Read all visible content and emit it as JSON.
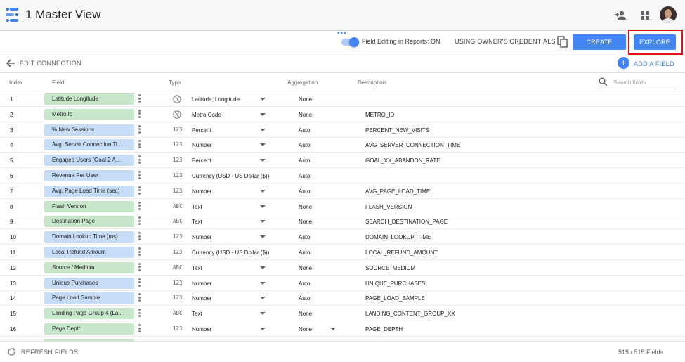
{
  "app": {
    "title": "1 Master View"
  },
  "toolbar": {
    "field_editing_label": "Field Editing in Reports: ON",
    "credentials_label": "USING OWNER'S CREDENTIALS",
    "create_report_label": "CREATE REPORT",
    "explore_label": "EXPLORE",
    "accent_color": "#4285f4",
    "highlight_color": "#e3101b"
  },
  "edit_bar": {
    "title": "EDIT CONNECTION",
    "add_field_label": "ADD A FIELD"
  },
  "columns": {
    "index": "Index",
    "field": "Field",
    "type": "Type",
    "aggregation": "Aggregation",
    "description": "Description"
  },
  "search": {
    "placeholder": "Search fields"
  },
  "fields": [
    {
      "index": "1",
      "name": "Latitude Longitude",
      "kind": "dimension",
      "type_icon": "globe-icon",
      "type": "Latitude, Longitude",
      "aggregation": "None",
      "description": ""
    },
    {
      "index": "2",
      "name": "Metro Id",
      "kind": "dimension",
      "type_icon": "globe-icon",
      "type": "Metro Code",
      "aggregation": "None",
      "description": "METRO_ID"
    },
    {
      "index": "3",
      "name": "% New Sessions",
      "kind": "metric",
      "type_icon": "123",
      "type": "Percent",
      "aggregation": "Auto",
      "description": "PERCENT_NEW_VISITS"
    },
    {
      "index": "4",
      "name": "Avg. Server Connection Ti...",
      "kind": "metric",
      "type_icon": "123",
      "type": "Number",
      "aggregation": "Auto",
      "description": "AVG_SERVER_CONNECTION_TIME"
    },
    {
      "index": "5",
      "name": "Engaged Users (Goal 2 A...",
      "kind": "metric",
      "type_icon": "123",
      "type": "Percent",
      "aggregation": "Auto",
      "description": "GOAL_XX_ABANDON_RATE"
    },
    {
      "index": "6",
      "name": "Revenue Per User",
      "kind": "metric",
      "type_icon": "123",
      "type": "Currency (USD - US Dollar ($))",
      "aggregation": "Auto",
      "description": ""
    },
    {
      "index": "7",
      "name": "Avg. Page Load Time (sec)",
      "kind": "metric",
      "type_icon": "123",
      "type": "Number",
      "aggregation": "Auto",
      "description": "AVG_PAGE_LOAD_TIME"
    },
    {
      "index": "8",
      "name": "Flash Version",
      "kind": "dimension",
      "type_icon": "ABC",
      "type": "Text",
      "aggregation": "None",
      "description": "FLASH_VERSION"
    },
    {
      "index": "9",
      "name": "Destination Page",
      "kind": "dimension",
      "type_icon": "ABC",
      "type": "Text",
      "aggregation": "None",
      "description": "SEARCH_DESTINATION_PAGE"
    },
    {
      "index": "10",
      "name": "Domain Lookup Time (ms)",
      "kind": "metric",
      "type_icon": "123",
      "type": "Number",
      "aggregation": "Auto",
      "description": "DOMAIN_LOOKUP_TIME"
    },
    {
      "index": "11",
      "name": "Local Refund Amount",
      "kind": "metric",
      "type_icon": "123",
      "type": "Currency (USD - US Dollar ($))",
      "aggregation": "Auto",
      "description": "LOCAL_REFUND_AMOUNT"
    },
    {
      "index": "12",
      "name": "Source / Medium",
      "kind": "dimension",
      "type_icon": "ABC",
      "type": "Text",
      "aggregation": "None",
      "description": "SOURCE_MEDIUM"
    },
    {
      "index": "13",
      "name": "Unique Purchases",
      "kind": "metric",
      "type_icon": "123",
      "type": "Number",
      "aggregation": "Auto",
      "description": "UNIQUE_PURCHASES"
    },
    {
      "index": "14",
      "name": "Page Load Sample",
      "kind": "metric",
      "type_icon": "123",
      "type": "Number",
      "aggregation": "Auto",
      "description": "PAGE_LOAD_SAMPLE"
    },
    {
      "index": "15",
      "name": "Landing Page Group 4 (La...",
      "kind": "dimension",
      "type_icon": "ABC",
      "type": "Text",
      "aggregation": "None",
      "description": "LANDING_CONTENT_GROUP_XX"
    },
    {
      "index": "16",
      "name": "Page Depth",
      "kind": "dimension",
      "type_icon": "123",
      "type": "Number",
      "aggregation": "None",
      "description": "PAGE_DEPTH"
    }
  ],
  "footer": {
    "refresh_label": "REFRESH FIELDS",
    "field_count": "515 / 515 Fields"
  }
}
